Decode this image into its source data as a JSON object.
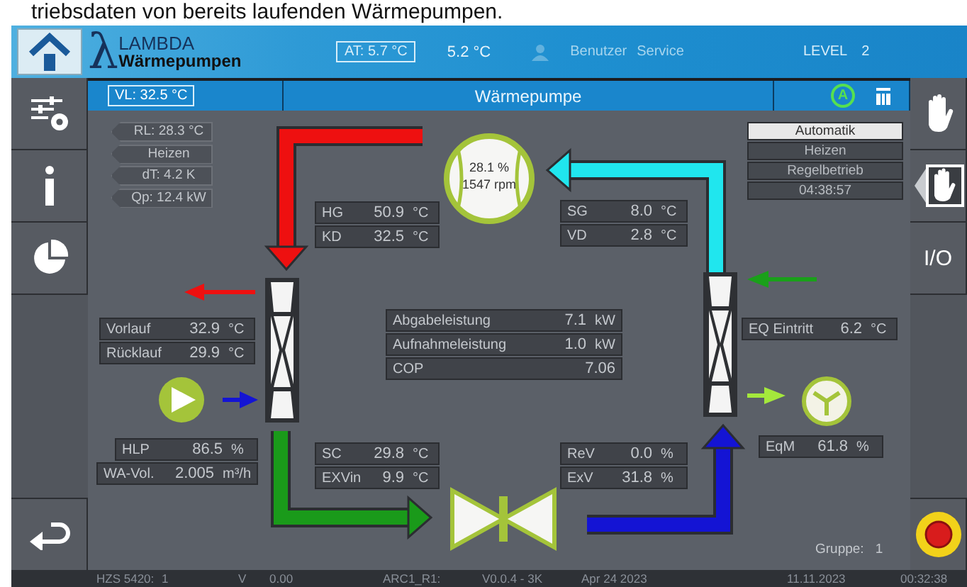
{
  "caption": "triebsdaten von bereits laufenden Wärmepumpen.",
  "header": {
    "logo_symbol": "λ",
    "logo_top": "LAMBDA",
    "logo_bottom": "Wärmepumpen",
    "outdoor": "AT:  5.7 °C",
    "temperature": "5.2 °C",
    "user_label": "Benutzer",
    "user": "Service",
    "level_label": "LEVEL",
    "level": "2"
  },
  "left_nav": [
    {
      "kind": "settings"
    },
    {
      "kind": "info"
    },
    {
      "kind": "statistics"
    },
    {
      "kind": "back"
    }
  ],
  "right_nav": [
    {
      "kind": "manual"
    },
    {
      "kind": "manual-release"
    },
    {
      "kind": "io",
      "label": "I/O"
    },
    {
      "kind": "emergency-stop"
    }
  ],
  "panel": {
    "setpoint": "VL: 32.5 °C",
    "title": "Wärmepumpe",
    "mode_badge": "A"
  },
  "status_tags": [
    "RL: 28.3 °C",
    "Heizen",
    "dT:   4.2 K",
    "Qp: 12.4 kW"
  ],
  "compressor": {
    "speed": "28.1 %",
    "rpm": "1547 rpm"
  },
  "modes": [
    {
      "label": "Automatik",
      "selected": true
    },
    {
      "label": "Heizen",
      "selected": false
    },
    {
      "label": "Regelbetrieb",
      "selected": false
    },
    {
      "label": "04:38:57",
      "selected": false
    }
  ],
  "readouts": {
    "hot": [
      {
        "label": "HG",
        "value": "50.9",
        "unit": "°C"
      },
      {
        "label": "KD",
        "value": "32.5",
        "unit": "°C"
      }
    ],
    "suction": [
      {
        "label": "SG",
        "value": "8.0",
        "unit": "°C"
      },
      {
        "label": "VD",
        "value": "2.8",
        "unit": "°C"
      }
    ],
    "heating": [
      {
        "label": "Vorlauf",
        "value": "32.9",
        "unit": "°C"
      },
      {
        "label": "Rücklauf",
        "value": "29.9",
        "unit": "°C"
      }
    ],
    "source": [
      {
        "label": "EQ Eintritt",
        "value": "6.2",
        "unit": "°C"
      }
    ],
    "pump": [
      {
        "label": "HLP",
        "value": "86.5",
        "unit": "%"
      },
      {
        "label": "WA-Vol.",
        "value": "2.005",
        "unit": "m³/h"
      }
    ],
    "sub": [
      {
        "label": "SC",
        "value": "29.8",
        "unit": "°C"
      },
      {
        "label": "EXVin",
        "value": "9.9",
        "unit": "°C"
      }
    ],
    "valves": [
      {
        "label": "ReV",
        "value": "0.0",
        "unit": "%"
      },
      {
        "label": "ExV",
        "value": "31.8",
        "unit": "%"
      }
    ],
    "fan": [
      {
        "label": "EqM",
        "value": "61.8",
        "unit": "%"
      }
    ],
    "power": [
      {
        "label": "Abgabeleistung",
        "value": "7.1",
        "unit": "kW"
      },
      {
        "label": "Aufnahmeleistung",
        "value": "1.0",
        "unit": "kW"
      },
      {
        "label": "COP",
        "value": "7.06"
      }
    ]
  },
  "group": {
    "label": "Gruppe:",
    "value": "1"
  },
  "status_bar": [
    "HZS 5420:",
    "1",
    "V",
    "0.00",
    "ARC1_R1:",
    "V0.0.4 - 3K",
    "Apr 24 2023",
    "11.11.2023",
    "00:32:38"
  ]
}
